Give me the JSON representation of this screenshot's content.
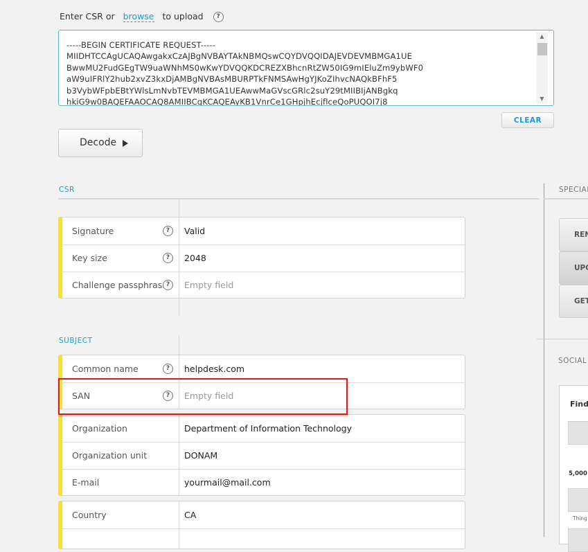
{
  "upload": {
    "prefix": "Enter CSR or",
    "browse_link": "browse",
    "suffix": "to upload"
  },
  "csr_text": "-----BEGIN CERTIFICATE REQUEST-----\nMIIDHTCCAgUCAQAwgakxCzAJBgNVBAYTAkNBMQswCQYDVQQIDAJEVDEVMBMGA1UE\nBwwMU2FudGEgTW9uaWNhMS0wKwYDVQQKDCREZXBhcnRtZW50IG9mIEluZm9ybWF0\naW9uIFRlY2hub2xvZ3kxDjAMBgNVBAsMBURPTkFNMSAwHgYJKoZIhvcNAQkBFhF5\nb3VybWFpbEBtYWlsLmNvbTEVMBMGA1UEAwwMaGVscGRlc2suY29tMIIBIjANBgkq\nhkiG9w0BAQEFAAOCAQ8AMIIBCgKCAQEAyKB1VnrCe1GHpjhEcjflceQoPUQOI7j8",
  "buttons": {
    "clear": "CLEAR",
    "decode": "Decode"
  },
  "sections": {
    "csr": "CSR",
    "subject": "SUBJECT",
    "special": "SPECIAL",
    "social": "SOCIAL"
  },
  "csr_fields": [
    {
      "label": "Signature",
      "value": "Valid"
    },
    {
      "label": "Key size",
      "value": "2048"
    },
    {
      "label": "Challenge passphrase",
      "value": "Empty field"
    }
  ],
  "subject_top": [
    {
      "label": "Common name",
      "value": "helpdesk.com"
    },
    {
      "label": "SAN",
      "value": "Empty field"
    }
  ],
  "subject_org": [
    {
      "label": "Organization",
      "value": "Department of Information Technology"
    },
    {
      "label": "Organization unit",
      "value": "DONAM"
    },
    {
      "label": "E-mail",
      "value": "yourmail@mail.com"
    }
  ],
  "subject_geo": [
    {
      "label": "Country",
      "value": "CA"
    }
  ],
  "side_buttons": {
    "renew": "REN",
    "upgrade": "UPG",
    "get": "GET"
  },
  "social": {
    "find": "Find",
    "count": "5,000",
    "thing": "Thing"
  },
  "colors": {
    "accent": "#1a9fc9",
    "marker": "#f5df3a",
    "highlight": "#d81c1c"
  }
}
